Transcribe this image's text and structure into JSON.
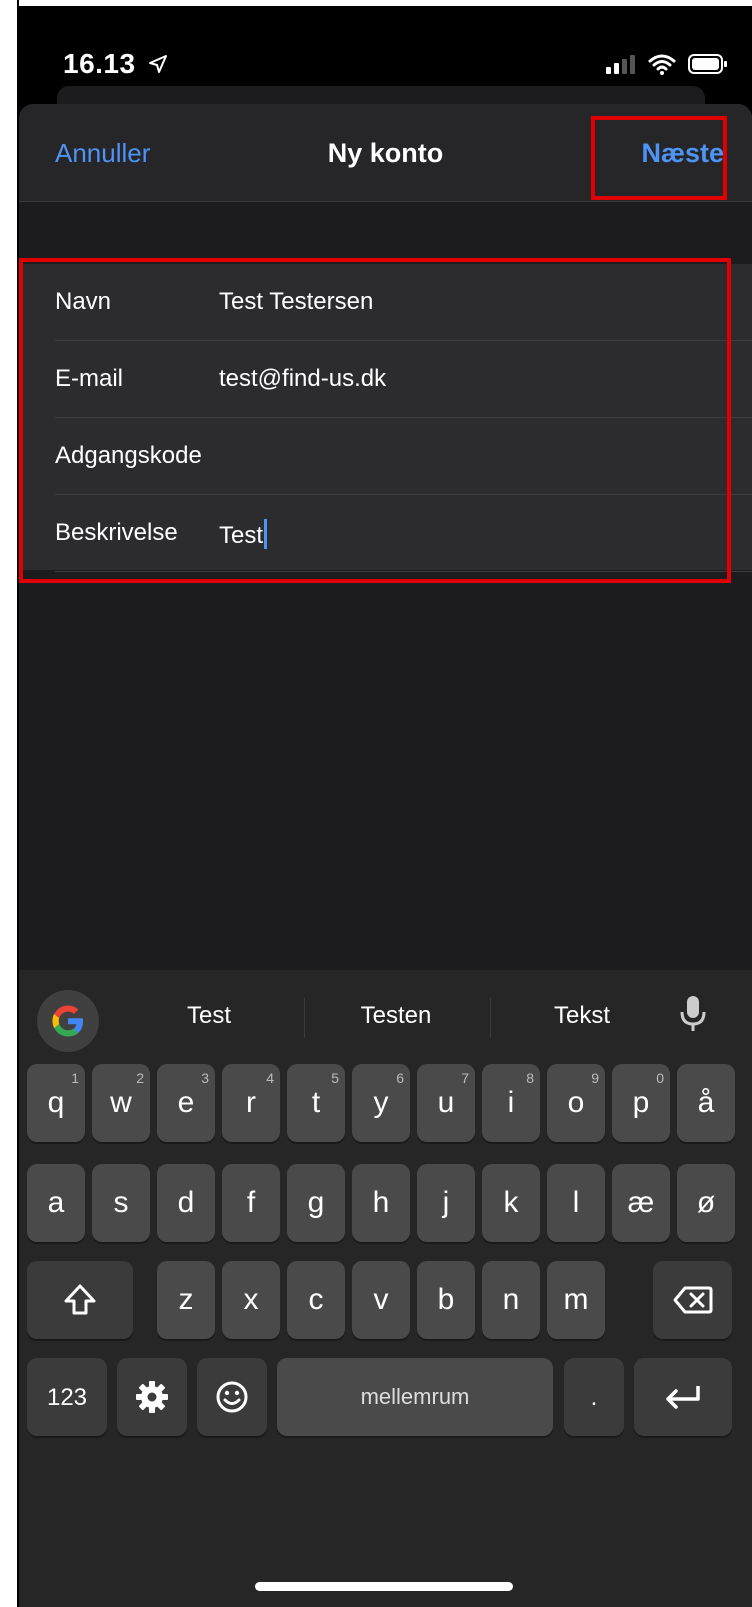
{
  "status": {
    "time": "16.13"
  },
  "nav": {
    "cancel": "Annuller",
    "title": "Ny konto",
    "next": "Næste"
  },
  "form": {
    "rows": [
      {
        "label": "Navn",
        "value": "Test Testersen"
      },
      {
        "label": "E-mail",
        "value": "test@find-us.dk"
      },
      {
        "label": "Adgangskode",
        "value": ""
      },
      {
        "label": "Beskrivelse",
        "value": "Test"
      }
    ]
  },
  "keyboard": {
    "suggestions": [
      "Test",
      "Testen",
      "Tekst"
    ],
    "row1": [
      [
        "q",
        "1"
      ],
      [
        "w",
        "2"
      ],
      [
        "e",
        "3"
      ],
      [
        "r",
        "4"
      ],
      [
        "t",
        "5"
      ],
      [
        "y",
        "6"
      ],
      [
        "u",
        "7"
      ],
      [
        "i",
        "8"
      ],
      [
        "o",
        "9"
      ],
      [
        "p",
        "0"
      ],
      [
        "å",
        ""
      ]
    ],
    "row2": [
      "a",
      "s",
      "d",
      "f",
      "g",
      "h",
      "j",
      "k",
      "l",
      "æ",
      "ø"
    ],
    "row3": [
      "z",
      "x",
      "c",
      "v",
      "b",
      "n",
      "m"
    ],
    "numbers_key": "123",
    "space": "mellemrum",
    "period": "."
  },
  "colors": {
    "accent": "#4d94f5",
    "highlight": "#e00000"
  },
  "icons": [
    "location-arrow-icon",
    "signal-icon",
    "wifi-icon",
    "battery-icon",
    "google-icon",
    "mic-icon",
    "shift-icon",
    "backspace-icon",
    "gear-icon",
    "emoji-icon",
    "return-icon"
  ]
}
